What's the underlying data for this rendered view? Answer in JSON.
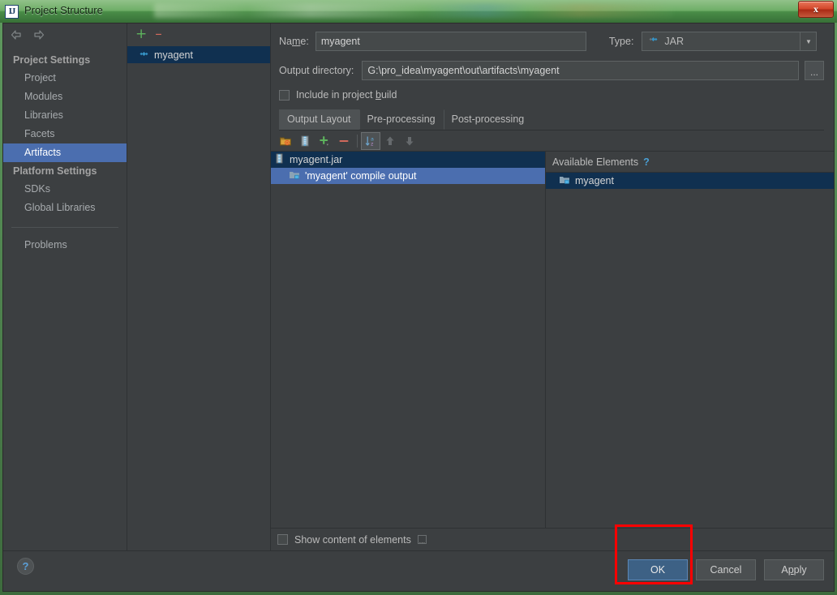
{
  "window": {
    "title": "Project Structure",
    "app_icon": "idea-icon",
    "close_label": "x"
  },
  "nav": {
    "back_icon": "arrow-left-icon",
    "forward_icon": "arrow-right-icon",
    "groups": [
      {
        "label": "Project Settings",
        "items": [
          {
            "label": "Project",
            "selected": false
          },
          {
            "label": "Modules",
            "selected": false
          },
          {
            "label": "Libraries",
            "selected": false
          },
          {
            "label": "Facets",
            "selected": false
          },
          {
            "label": "Artifacts",
            "selected": true
          }
        ]
      },
      {
        "label": "Platform Settings",
        "items": [
          {
            "label": "SDKs",
            "selected": false
          },
          {
            "label": "Global Libraries",
            "selected": false
          }
        ]
      }
    ],
    "problems": "Problems"
  },
  "artifact_panel": {
    "add_label": "+",
    "remove_label": "–",
    "items": [
      {
        "label": "myagent",
        "icon": "artifact-icon",
        "selected": true
      }
    ]
  },
  "editor": {
    "name_label_pre": "Na",
    "name_label_mnemonic": "m",
    "name_label_post": "e:",
    "name_value": "myagent",
    "name_placeholder": "",
    "type_label": "Type:",
    "type_value": "JAR",
    "type_arrow_icon": "chevron-down-icon",
    "outdir_label": "Output directory:",
    "outdir_value": "G:\\pro_idea\\myagent\\out\\artifacts\\myagent",
    "outdir_placeholder": "",
    "outdir_browse_label": "...",
    "include_pre": "Include in project ",
    "include_mnemonic": "b",
    "include_post": "uild",
    "include_checked": false,
    "tabs": [
      {
        "label": "Output Layout",
        "active": true
      },
      {
        "label": "Pre-processing",
        "active": false
      },
      {
        "label": "Post-processing",
        "active": false
      }
    ],
    "toolbar": [
      {
        "name": "create-directory-icon",
        "pressed": false,
        "disabled": false
      },
      {
        "name": "create-archive-icon",
        "pressed": false,
        "disabled": false
      },
      {
        "name": "add-copy-icon",
        "pressed": false,
        "disabled": false
      },
      {
        "name": "remove-icon",
        "pressed": false,
        "disabled": false
      },
      {
        "name": "sort-alphabetically-icon",
        "pressed": true,
        "disabled": false
      },
      {
        "name": "move-up-icon",
        "pressed": false,
        "disabled": true
      },
      {
        "name": "move-down-icon",
        "pressed": false,
        "disabled": true
      }
    ],
    "output_tree": [
      {
        "label": "myagent.jar",
        "depth": 0,
        "icon": "jar-icon",
        "state": "dark"
      },
      {
        "label": "'myagent' compile output",
        "depth": 1,
        "icon": "compile-output-icon",
        "state": "blue"
      }
    ],
    "available_header": "Available Elements",
    "available_help": "?",
    "available_items": [
      {
        "label": "myagent",
        "icon": "module-output-icon",
        "state": "dark"
      }
    ],
    "show_content_label": "Show content of elements",
    "show_content_checked": false,
    "show_content_extra": "..."
  },
  "footer": {
    "help_label": "?",
    "ok_label": "OK",
    "cancel_label": "Cancel",
    "apply_pre": "A",
    "apply_mnemonic": "p",
    "apply_post": "ply"
  },
  "annotation": {
    "shape": "rectangle",
    "color": "#ff0000",
    "target": "ok-button"
  },
  "colors": {
    "panel_bg": "#3c3f41",
    "selection_blue": "#4b6eaf",
    "selection_dark": "#103050",
    "accent_link": "#4a9fd4",
    "primary_button": "#3d6185",
    "titlebar_green": "#6fae68",
    "annotation_red": "#ff0000"
  }
}
